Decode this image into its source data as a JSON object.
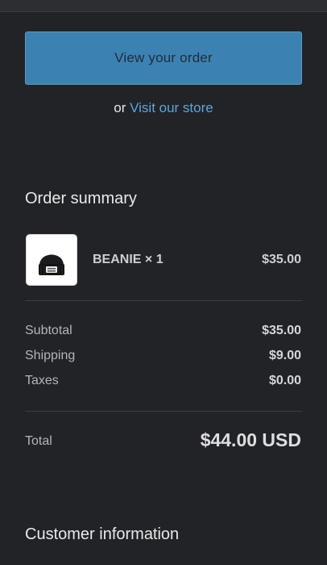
{
  "actions": {
    "view_order_label": "View your order",
    "store_prefix": "or",
    "store_link_label": "Visit our store"
  },
  "order_summary": {
    "title": "Order summary",
    "item": {
      "name": "BEANIE × 1",
      "price": "$35.00",
      "image_icon": "beanie-image"
    },
    "rows": [
      {
        "label": "Subtotal",
        "value": "$35.00"
      },
      {
        "label": "Shipping",
        "value": "$9.00"
      },
      {
        "label": "Taxes",
        "value": "$0.00"
      }
    ],
    "total": {
      "label": "Total",
      "value": "$44.00 USD"
    }
  },
  "customer_information": {
    "title": "Customer information"
  },
  "colors": {
    "background": "#222327",
    "primary_button": "#3b82b2",
    "link": "#5ca6d8"
  }
}
